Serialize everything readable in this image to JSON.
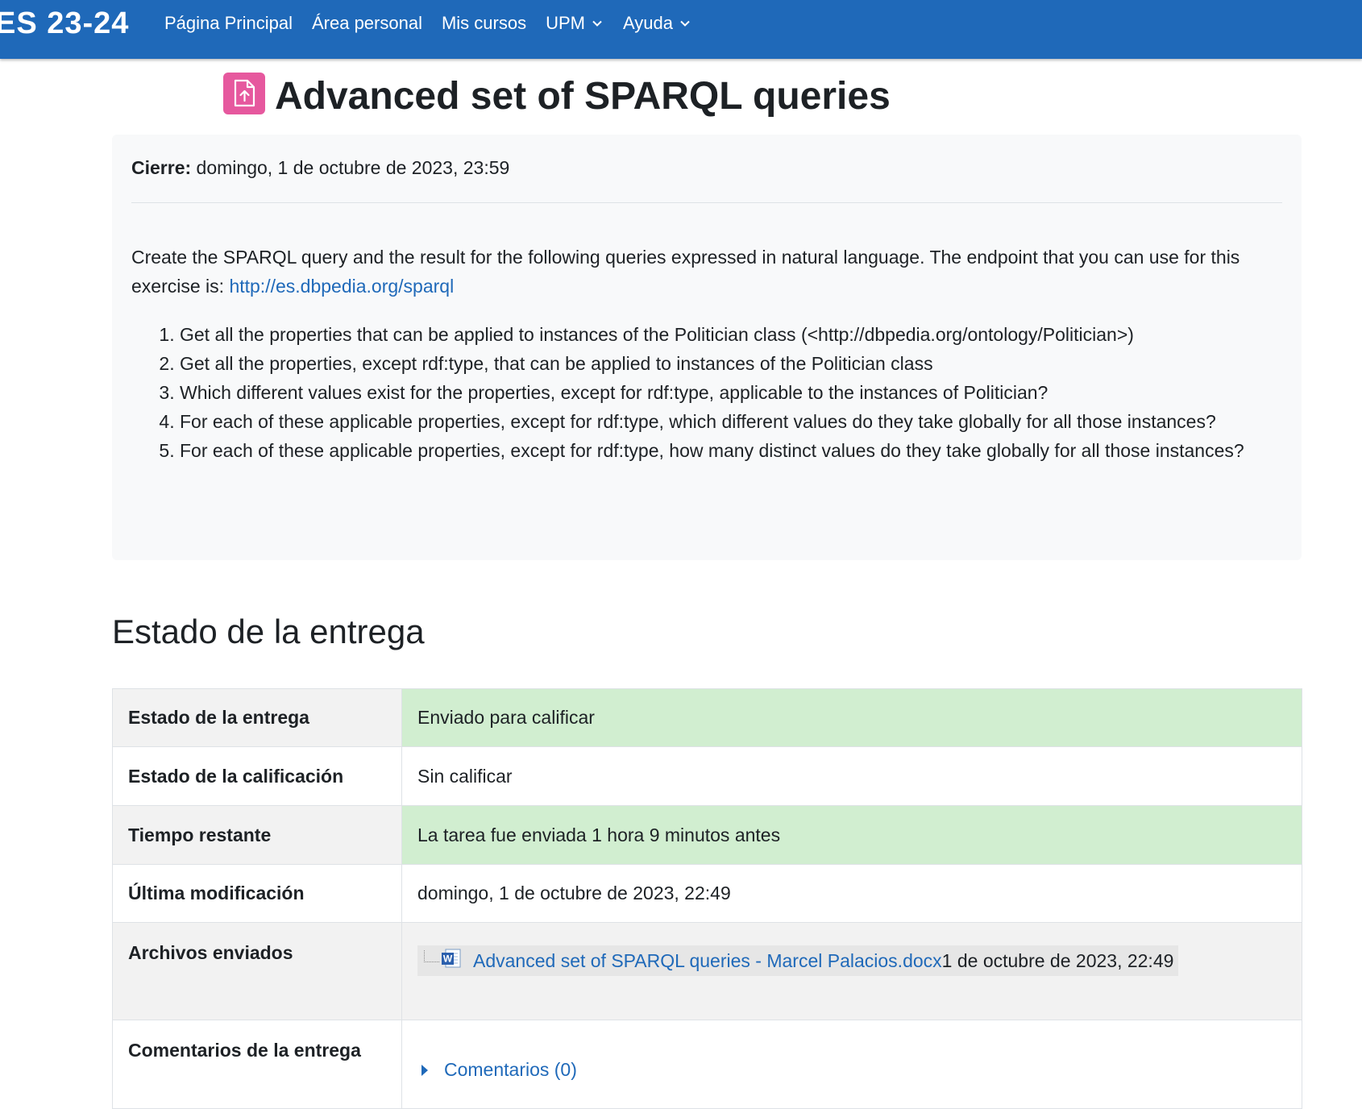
{
  "navbar": {
    "brand": "ES 23-24",
    "items": [
      {
        "label": "Página Principal",
        "has_dropdown": false
      },
      {
        "label": "Área personal",
        "has_dropdown": false
      },
      {
        "label": "Mis cursos",
        "has_dropdown": false
      },
      {
        "label": "UPM",
        "has_dropdown": true
      },
      {
        "label": "Ayuda",
        "has_dropdown": true
      }
    ]
  },
  "page": {
    "title": "Advanced set of SPARQL queries",
    "icon": "assignment-upload-icon",
    "icon_color": "#e6589e"
  },
  "intro": {
    "due_label": "Cierre:",
    "due_value": "domingo, 1 de octubre de 2023, 23:59",
    "description_text": "Create the SPARQL query and the result for the following queries expressed in natural language. The endpoint that you can use for this exercise is: ",
    "endpoint_link": "http://es.dbpedia.org/sparql",
    "queries": [
      "Get all the properties that can be applied to instances of the Politician class (<http://dbpedia.org/ontology/Politician>)",
      "Get all the properties, except rdf:type, that can be applied to instances of the Politician class",
      "Which different values exist for the properties, except for rdf:type, applicable to the instances of Politician?",
      "For each of these applicable properties, except for rdf:type, which different values do they take globally for all those instances?",
      "For each of these applicable properties, except for rdf:type, how many distinct values do they take globally for all those instances?"
    ]
  },
  "submission": {
    "section_title": "Estado de la entrega",
    "rows": {
      "status": {
        "label": "Estado de la entrega",
        "value": "Enviado para calificar"
      },
      "grading": {
        "label": "Estado de la calificación",
        "value": "Sin calificar"
      },
      "time_remaining": {
        "label": "Tiempo restante",
        "value": "La tarea fue enviada 1 hora 9 minutos antes"
      },
      "last_modified": {
        "label": "Última modificación",
        "value": "domingo, 1 de octubre de 2023, 22:49"
      },
      "files": {
        "label": "Archivos enviados",
        "file_name": "Advanced set of SPARQL queries - Marcel Palacios.docx",
        "file_date": "1 de octubre de 2023, 22:49",
        "file_icon": "word-document-icon"
      },
      "comments": {
        "label": "Comentarios de la entrega",
        "link": "Comentarios (0)"
      }
    },
    "ok_color": "#d1eed0"
  },
  "colors": {
    "navbar": "#1f69b9",
    "link": "#1f69b9"
  }
}
